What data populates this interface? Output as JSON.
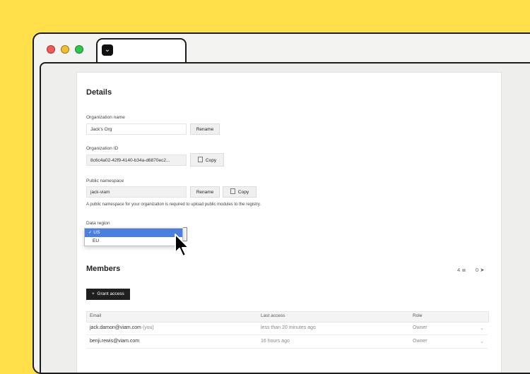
{
  "window": {
    "colors": {
      "close": "#EF5C57",
      "minimize": "#F2BE2D",
      "maximize": "#2DC84A",
      "background": "#FFE04A"
    },
    "tab_icon": "viam-chevron-logo"
  },
  "details": {
    "title": "Details",
    "org_name": {
      "label": "Organization name",
      "value": "Jack's Org",
      "button": "Rename"
    },
    "org_id": {
      "label": "Organization ID",
      "value": "8c6c4a02-42f9-4140-b34a-d6870ec2...",
      "button": "Copy"
    },
    "namespace": {
      "label": "Public namespace",
      "value": "jack-viam",
      "rename_button": "Rename",
      "copy_button": "Copy",
      "hint": "A public namespace for your organization is required to upload public modules to the registry."
    },
    "region": {
      "label": "Data region",
      "options": [
        "US",
        "EU"
      ],
      "selected": "US",
      "check": "✓"
    }
  },
  "members": {
    "title": "Members",
    "member_count": "4",
    "invite_count": "0",
    "grant_button": "Grant access",
    "columns": [
      "Email",
      "Last access",
      "Role"
    ],
    "rows": [
      {
        "email": "jack.damon@viam.com",
        "you": "(you)",
        "last_access": "less than 20 minutes ago",
        "role": "Owner"
      },
      {
        "email": "benji.rewis@viam.com",
        "you": "",
        "last_access": "16 hours ago",
        "role": "Owner"
      }
    ]
  }
}
